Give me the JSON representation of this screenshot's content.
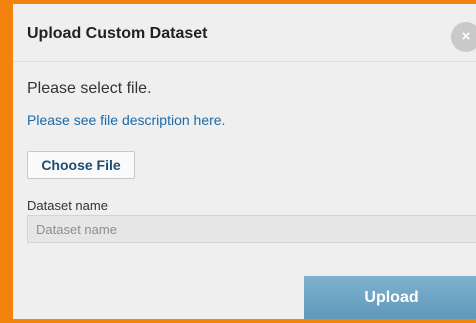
{
  "dialog": {
    "title": "Upload Custom Dataset",
    "close_icon": "×",
    "prompt": "Please select file.",
    "description_link": "Please see file description here.",
    "choose_file_label": "Choose File",
    "dataset_name_label": "Dataset name",
    "dataset_name_placeholder": "Dataset name",
    "dataset_name_value": "",
    "upload_label": "Upload"
  },
  "colors": {
    "frame_border": "#f2840d",
    "dialog_background": "#efefef",
    "link": "#1a6aa6",
    "upload_button": "#6ca4c4"
  },
  "icons": {
    "close": "close-icon"
  }
}
